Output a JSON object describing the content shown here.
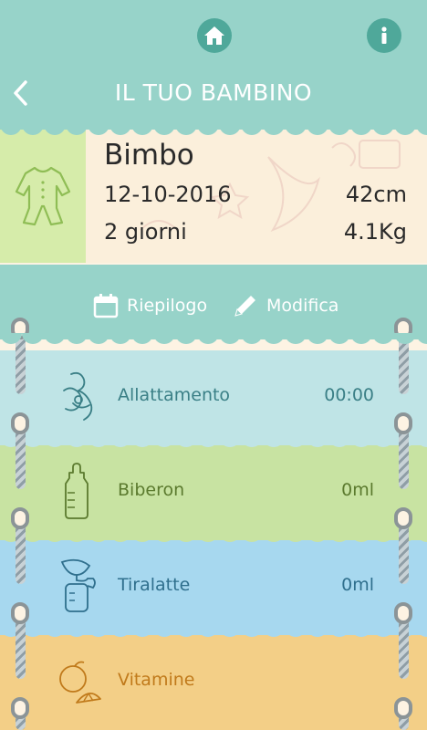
{
  "colors": {
    "teal": "#97d3c9",
    "teal_dark": "#4fa89a",
    "cream": "#fbefdb",
    "green_light": "#d6ecaa"
  },
  "topbar": {
    "home_icon": "home-icon",
    "info_icon": "info-icon"
  },
  "header": {
    "title": "IL TUO BAMBINO",
    "back_icon": "chevron-left-icon"
  },
  "profile": {
    "icon": "baby-onesie-icon",
    "name": "Bimbo",
    "birthdate": "12-10-2016",
    "age": "2 giorni",
    "height": "42cm",
    "weight": "4.1Kg"
  },
  "actions": {
    "summary_label": "Riepilogo",
    "summary_icon": "calendar-icon",
    "edit_label": "Modifica",
    "edit_icon": "pencil-icon"
  },
  "sections": [
    {
      "label": "Allattamento",
      "value": "00:00",
      "icon": "breastfeeding-icon",
      "bg": "#bfe4e6",
      "text_color": "#3a7f86"
    },
    {
      "label": "Biberon",
      "value": "0ml",
      "icon": "baby-bottle-icon",
      "bg": "#c8e3a2",
      "text_color": "#5b7a2e"
    },
    {
      "label": "Tiralatte",
      "value": "0ml",
      "icon": "breast-pump-icon",
      "bg": "#a7d8ef",
      "text_color": "#2f6f8d"
    },
    {
      "label": "Vitamine",
      "value": "",
      "icon": "citrus-icon",
      "bg": "#f3cf87",
      "text_color": "#c07a1b"
    }
  ]
}
